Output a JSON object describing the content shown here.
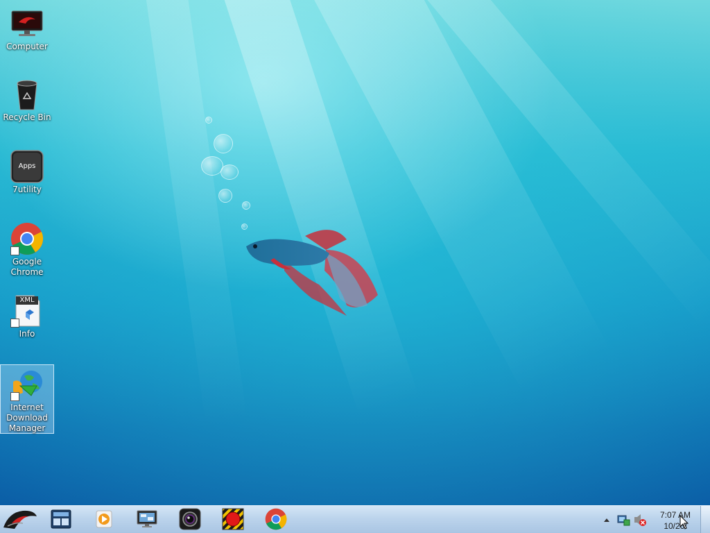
{
  "desktop": {
    "icons": [
      {
        "label": "Computer",
        "icon": "computer-icon"
      },
      {
        "label": "Recycle Bin",
        "icon": "recycle-bin-icon"
      },
      {
        "label": "7utility",
        "icon": "apps-icon",
        "badge": "Apps"
      },
      {
        "label": "Google Chrome",
        "icon": "chrome-icon"
      },
      {
        "label": "Info",
        "icon": "xml-file-icon",
        "badge": "XML"
      },
      {
        "label": "Internet Download Manager",
        "icon": "idm-icon",
        "selected": true
      }
    ]
  },
  "taskbar": {
    "pinned": [
      {
        "name": "start-button",
        "icon": "rog-logo-icon"
      },
      {
        "name": "taskbar-item-1",
        "icon": "window-switcher-icon"
      },
      {
        "name": "taskbar-item-2",
        "icon": "media-player-icon"
      },
      {
        "name": "taskbar-item-3",
        "icon": "monitor-icon"
      },
      {
        "name": "taskbar-item-4",
        "icon": "camera-icon"
      },
      {
        "name": "taskbar-item-5",
        "icon": "record-icon"
      },
      {
        "name": "taskbar-item-6",
        "icon": "chrome-icon"
      }
    ],
    "tray": {
      "icons": [
        "show-hidden-icons-chevron-icon",
        "network-icon",
        "volume-muted-icon"
      ]
    },
    "clock": {
      "time": "7:07 AM",
      "date": "10/26/"
    }
  },
  "colors": {
    "taskbar_bg": "#bcd4ec",
    "desktop_top": "#6fd8de",
    "desktop_bottom": "#0b5ea6",
    "chrome_red": "#db4437",
    "chrome_yellow": "#f4b400",
    "chrome_green": "#0f9d58",
    "chrome_blue": "#4285f4"
  }
}
